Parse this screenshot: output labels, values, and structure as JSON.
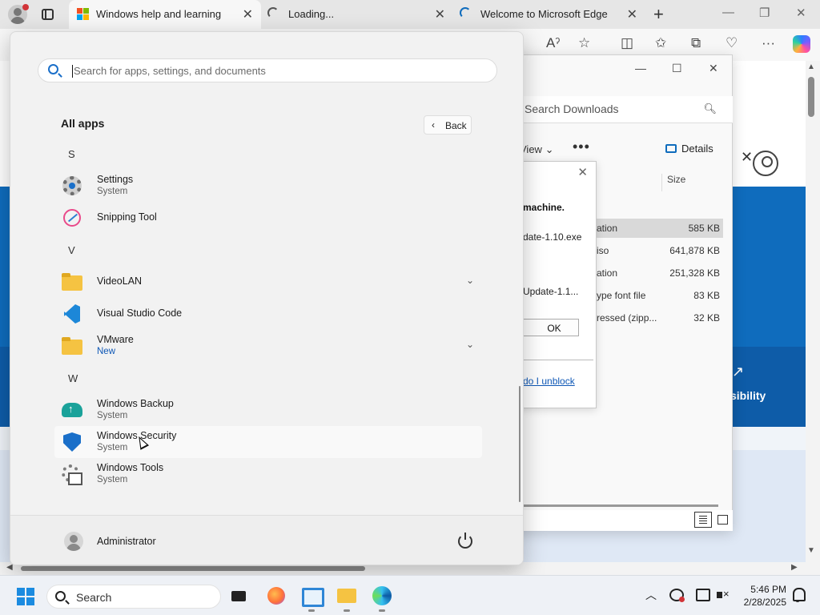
{
  "browser": {
    "tabs": [
      {
        "title": "Windows help and learning",
        "active": true,
        "icon": "windows-logo-icon"
      },
      {
        "title": "Loading...",
        "active": false,
        "icon": "loading-spinner-icon"
      },
      {
        "title": "Welcome to Microsoft Edge",
        "active": false,
        "icon": "loading-spinner-icon"
      }
    ],
    "toolbar_icons": [
      "read-aloud-icon",
      "favorite-star-icon",
      "split-screen-icon",
      "favorites-icon",
      "collections-icon",
      "browser-essentials-icon",
      "more-icon",
      "copilot-icon"
    ],
    "page_text": {
      "accessibility": "sibility"
    }
  },
  "explorer": {
    "search_placeholder": "Search Downloads",
    "view_label": "View",
    "details_label": "Details",
    "size_header": "Size",
    "rows": [
      {
        "type": "ation",
        "size": "585 KB",
        "selected": true
      },
      {
        "type": "iso",
        "size": "641,878 KB",
        "selected": false
      },
      {
        "type": "ation",
        "size": "251,328 KB",
        "selected": false
      },
      {
        "type": "ype font file",
        "size": "83 KB",
        "selected": false
      },
      {
        "type": "ressed (zipp...",
        "size": "32 KB",
        "selected": false
      }
    ]
  },
  "dialog": {
    "message": "machine.",
    "file1": "date-1.10.exe",
    "file2": "Update-1.1...",
    "ok_label": "OK",
    "link": "do I unblock"
  },
  "start": {
    "search_placeholder": "Search for apps, settings, and documents",
    "all_apps_title": "All apps",
    "back_label": "Back",
    "letters": {
      "s": "S",
      "v": "V",
      "w": "W"
    },
    "apps": {
      "settings": {
        "name": "Settings",
        "sub": "System"
      },
      "snipping": {
        "name": "Snipping Tool"
      },
      "videolan": {
        "name": "VideoLAN"
      },
      "vscode": {
        "name": "Visual Studio Code"
      },
      "vmware": {
        "name": "VMware",
        "sub": "New"
      },
      "backup": {
        "name": "Windows Backup",
        "sub": "System"
      },
      "security": {
        "name": "Windows Security",
        "sub": "System"
      },
      "tools": {
        "name": "Windows Tools",
        "sub": "System"
      }
    },
    "user_name": "Administrator"
  },
  "taskbar": {
    "search_label": "Search",
    "apps": [
      "task-view-icon",
      "firefox-icon",
      "remote-desktop-icon",
      "file-explorer-icon",
      "edge-icon"
    ],
    "time": "5:46 PM",
    "date": "2/28/2025"
  }
}
